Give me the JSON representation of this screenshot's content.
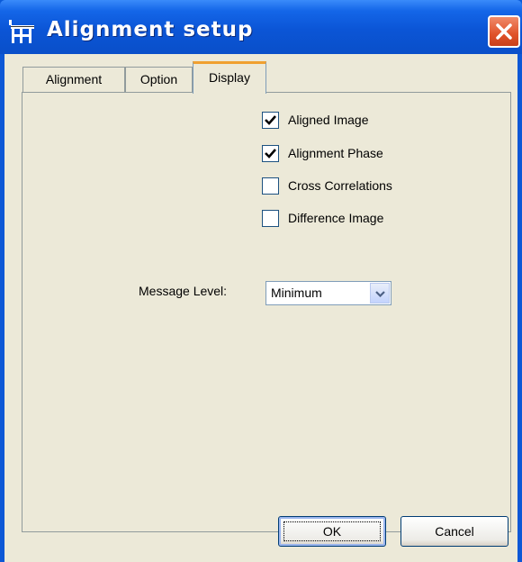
{
  "window": {
    "title": "Alignment setup",
    "title_bar_color": "#0b55d6",
    "close_button_color": "#e0522a"
  },
  "tabs": [
    {
      "label": "Alignment",
      "active": false
    },
    {
      "label": "Option",
      "active": false
    },
    {
      "label": "Display",
      "active": true
    }
  ],
  "display": {
    "checkboxes": [
      {
        "label": "Aligned Image",
        "checked": true
      },
      {
        "label": "Alignment Phase",
        "checked": true
      },
      {
        "label": "Cross Correlations",
        "checked": false
      },
      {
        "label": "Difference Image",
        "checked": false
      }
    ],
    "message_level": {
      "label": "Message Level:",
      "selected": "Minimum"
    }
  },
  "buttons": {
    "ok_label": "OK",
    "cancel_label": "Cancel"
  },
  "icons": {
    "app": "grid-app-icon",
    "close": "close-icon",
    "check": "check-icon",
    "dropdown": "chevron-down-icon"
  }
}
